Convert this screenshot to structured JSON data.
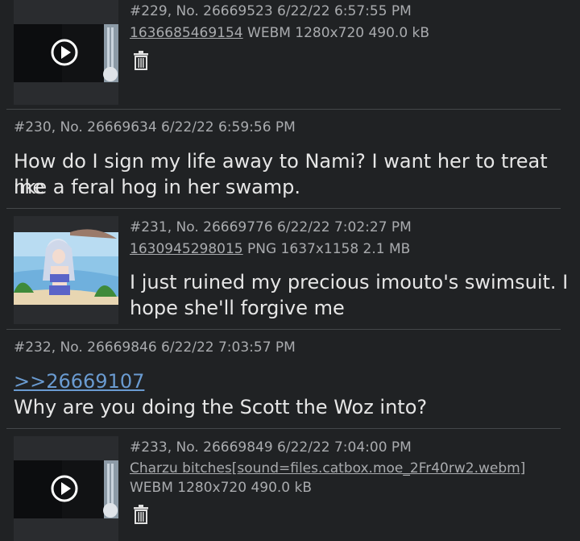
{
  "posts": [
    {
      "meta": "#229, No. 26669523 6/22/22 6:57:55 PM",
      "file_name": "1636685469154",
      "file_info": " WEBM 1280x720 490.0 kB",
      "thumb_icon": "play-icon",
      "action_icon": "trash-icon"
    },
    {
      "meta": "#230, No. 26669634 6/22/22 6:59:56 PM",
      "body_line1": "How do I sign my life away to Nami? I want her to treat me",
      "body_line2": "like a feral hog in her swamp."
    },
    {
      "meta": "#231, No. 26669776 6/22/22 7:02:27 PM",
      "file_name": "1630945298015",
      "file_info": " PNG 1637x1158 2.1 MB",
      "body_line1": "I just ruined my precious imouto's swimsuit. I",
      "body_line2": "hope she'll forgive me"
    },
    {
      "meta": "#232, No. 26669846 6/22/22 7:03:57 PM",
      "quote": ">>26669107",
      "body_line1": "Why are you doing the Scott the Woz into?"
    },
    {
      "meta": "#233, No. 26669849 6/22/22 7:04:00 PM",
      "file_name": "Charzu bitches[sound=files.catbox.moe_2Fr40rw2.webm]",
      "file_info": "WEBM 1280x720 490.0 kB",
      "thumb_icon": "play-icon",
      "action_icon": "trash-icon"
    }
  ],
  "colors": {
    "background": "#202224",
    "text": "#e6e6e6",
    "meta": "#a9abae",
    "link": "#6a9bd1",
    "divider": "#44474a"
  }
}
